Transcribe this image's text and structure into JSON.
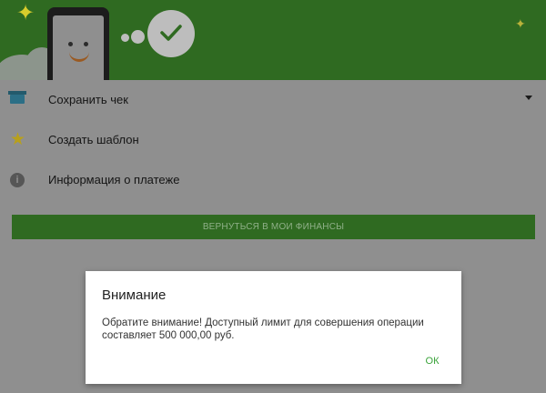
{
  "list": {
    "items": [
      {
        "label": "Сохранить чек",
        "icon": "receipt-icon"
      },
      {
        "label": "Создать шаблон",
        "icon": "star-icon"
      },
      {
        "label": "Информация о платеже",
        "icon": "info-icon"
      }
    ]
  },
  "actions": {
    "return_label": "ВЕРНУТЬСЯ В МОИ ФИНАНСЫ"
  },
  "dialog": {
    "title": "Внимание",
    "message": "Обратите внимание! Доступный лимит для совершения операции составляет 500 000,00 руб.",
    "ok_label": "ОК"
  },
  "colors": {
    "brand_green": "#2f6a21",
    "ok_green": "#3aa33a",
    "overlay_gray": "#8f8f8f"
  }
}
